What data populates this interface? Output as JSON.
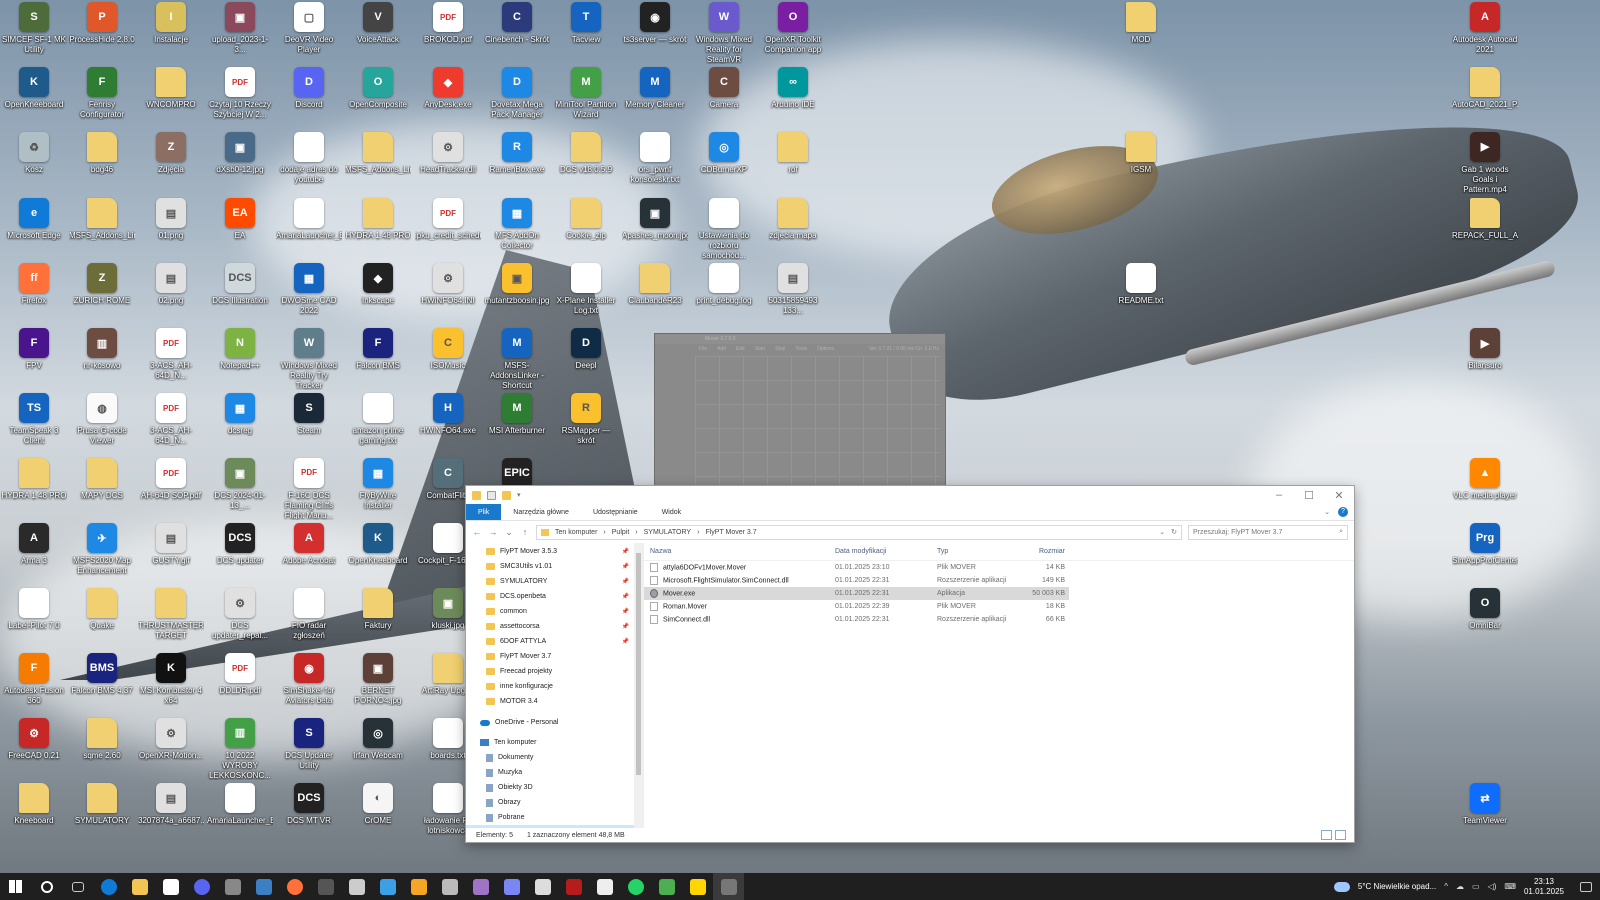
{
  "desktop": {
    "icons": [
      {
        "label": "SIMCEF SF-1 MK Utility",
        "color": "#4e6b3a",
        "glyph": "S"
      },
      {
        "label": "ProcessHide 2.8.0",
        "color": "#e0572a",
        "glyph": "P"
      },
      {
        "label": "Instalacje",
        "color": "#d8c05c",
        "glyph": "I"
      },
      {
        "label": "upload_2023-1-3...",
        "color": "#8a4a5c",
        "glyph": "▣"
      },
      {
        "label": "DeoVR Video Player",
        "color": "#ffffff",
        "glyph": "▢"
      },
      {
        "label": "VoiceAttack",
        "color": "#444444",
        "glyph": "V"
      },
      {
        "label": "BROKOD.pdf",
        "color": "#d32f2f",
        "glyph": "PDF"
      },
      {
        "label": "Cinebench - Skrót",
        "color": "#2a3a7a",
        "glyph": "C"
      },
      {
        "label": "Tacview",
        "color": "#1565c0",
        "glyph": "T"
      },
      {
        "label": "ts3server — skrót",
        "color": "#222222",
        "glyph": "◉"
      },
      {
        "label": "Windows Mixed Reality for SteamVR",
        "color": "#6a5acd",
        "glyph": "W"
      },
      {
        "label": "OpenXR Toolkit Companion app",
        "color": "#7b1fa2",
        "glyph": "O"
      },
      {
        "label": "MOD",
        "color": "#f0d070",
        "glyph": ""
      },
      {
        "label": "Autodesk Autocad 2021",
        "color": "#c62828",
        "glyph": "A"
      }
    ],
    "icons_row2": [
      {
        "label": "OpenKneeboard",
        "color": "#1e5a8a",
        "glyph": "K"
      },
      {
        "label": "Fenrisy Configurator",
        "color": "#2e7d32",
        "glyph": "F"
      },
      {
        "label": "WNCOMPRO",
        "color": "#f0d070",
        "glyph": ""
      },
      {
        "label": "Czytaj 10 Rzeczy Szybciej W 2...",
        "color": "#d32f2f",
        "glyph": "PDF"
      },
      {
        "label": "Discord",
        "color": "#5865f2",
        "glyph": "D"
      },
      {
        "label": "OpenComposite",
        "color": "#26a69a",
        "glyph": "O"
      },
      {
        "label": "AnyDesk.exe",
        "color": "#ef3b2d",
        "glyph": "◆"
      },
      {
        "label": "Dovetax Mega Pack Manager",
        "color": "#1e88e5",
        "glyph": "D"
      },
      {
        "label": "MiniTool Partition Wizard",
        "color": "#43a047",
        "glyph": "M"
      },
      {
        "label": "Memory Cleaner",
        "color": "#1565c0",
        "glyph": "M"
      },
      {
        "label": "Camera",
        "color": "#6d4c41",
        "glyph": "C"
      },
      {
        "label": "Arduino IDE",
        "color": "#00979d",
        "glyph": "∞"
      },
      {
        "label": "AutoCAD_2021_P...",
        "color": "#f0d070",
        "glyph": ""
      }
    ],
    "icons_row3": [
      {
        "label": "Kosz",
        "color": "#b0bec5",
        "glyph": "♻"
      },
      {
        "label": "bdg46",
        "color": "#f0d070",
        "glyph": ""
      },
      {
        "label": "Zdjęcia",
        "color": "#8d6e63",
        "glyph": "Z"
      },
      {
        "label": "dXsb0-12.jpg",
        "color": "#4a6a8a",
        "glyph": "▣"
      },
      {
        "label": "dodaje adres do youtube",
        "color": "#ffffff",
        "glyph": ""
      },
      {
        "label": "MSFS_Addons_Lin...",
        "color": "#f0d070",
        "glyph": ""
      },
      {
        "label": "HeadTracker.dll",
        "color": "#e0e0e0",
        "glyph": "⚙"
      },
      {
        "label": "RamenBox.exe",
        "color": "#1e88e5",
        "glyph": "R"
      },
      {
        "label": "DCS v18.0.5.9",
        "color": "#f0d070",
        "glyph": ""
      },
      {
        "label": "ors_pwnf konsoleskr.txt",
        "color": "#ffffff",
        "glyph": ""
      },
      {
        "label": "CDBurnerXP",
        "color": "#1e88e5",
        "glyph": "◎"
      },
      {
        "label": "rof",
        "color": "#f0d070",
        "glyph": ""
      },
      {
        "label": "IGSM",
        "color": "#f0d070",
        "glyph": ""
      },
      {
        "label": "Gab 1 woods Goals i Pattern.mp4",
        "color": "#3e2723",
        "glyph": "▶"
      }
    ],
    "icons_row4": [
      {
        "label": "Microsoft Edge",
        "color": "#0f7bd6",
        "glyph": "e"
      },
      {
        "label": "MSFS_Addons_Lin...",
        "color": "#f0d070",
        "glyph": ""
      },
      {
        "label": "01.png",
        "color": "#e0e0e0",
        "glyph": "▤"
      },
      {
        "label": "EA",
        "color": "#ff4b00",
        "glyph": "EA"
      },
      {
        "label": "AmariaLauncher_E...",
        "color": "#ffffff",
        "glyph": ""
      },
      {
        "label": "HYDRA 1.48 PRO",
        "color": "#f0d070",
        "glyph": ""
      },
      {
        "label": "ipku_credit_schedu...",
        "color": "#d32f2f",
        "glyph": "PDF"
      },
      {
        "label": "MFS AddOn Collector",
        "color": "#1e88e5",
        "glyph": "▦"
      },
      {
        "label": "Cookie_zip",
        "color": "#f0d070",
        "glyph": ""
      },
      {
        "label": "Apashes_moon.jpg",
        "color": "#263238",
        "glyph": "▣"
      },
      {
        "label": "Ustawienia do rozbioru samochód...",
        "color": "#ffffff",
        "glyph": ""
      },
      {
        "label": "zdjecia mapa",
        "color": "#f0d070",
        "glyph": ""
      },
      {
        "label": "REPACK_FULL_Aut...",
        "color": "#f0d070",
        "glyph": ""
      }
    ],
    "icons_row5": [
      {
        "label": "Firefox",
        "color": "#ff7139",
        "glyph": "ff"
      },
      {
        "label": "ZURICH ROME",
        "color": "#6d6d3a",
        "glyph": "Z"
      },
      {
        "label": "02.png",
        "color": "#e0e0e0",
        "glyph": "▤"
      },
      {
        "label": "DCS Illustration",
        "color": "#cfd8dc",
        "glyph": "DCS"
      },
      {
        "label": "DWOSme CAD 2022",
        "color": "#1565c0",
        "glyph": "▦"
      },
      {
        "label": "Inkscape",
        "color": "#222222",
        "glyph": "◆"
      },
      {
        "label": "HWiNFO64.INI",
        "color": "#e0e0e0",
        "glyph": "⚙"
      },
      {
        "label": "mutantzboosin.jpg",
        "color": "#fbc02d",
        "glyph": "▣"
      },
      {
        "label": "X-Plane Installer Log.txt",
        "color": "#ffffff",
        "glyph": ""
      },
      {
        "label": "ClaubandeR23",
        "color": "#f0d070",
        "glyph": ""
      },
      {
        "label": "print_debug.log",
        "color": "#ffffff",
        "glyph": ""
      },
      {
        "label": "50315859493 133...",
        "color": "#e0e0e0",
        "glyph": "▤"
      },
      {
        "label": "README.txt",
        "color": "#ffffff",
        "glyph": ""
      }
    ],
    "icons_row6": [
      {
        "label": "FPV",
        "color": "#4a148c",
        "glyph": "F"
      },
      {
        "label": "nr-kosowo",
        "color": "#6d4c41",
        "glyph": "▥"
      },
      {
        "label": "3-ACS_AH-64D_N...",
        "color": "#d32f2f",
        "glyph": "PDF"
      },
      {
        "label": "Notepad++",
        "color": "#7cb342",
        "glyph": "N"
      },
      {
        "label": "Windows Mixed Reality Try Tracker",
        "color": "#607d8b",
        "glyph": "W"
      },
      {
        "label": "Falcon BMS",
        "color": "#1a237e",
        "glyph": "F"
      },
      {
        "label": "ISOMusic",
        "color": "#fbc02d",
        "glyph": "C"
      },
      {
        "label": "MSFS-AddonsLinker - Shortcut",
        "color": "#1565c0",
        "glyph": "M"
      },
      {
        "label": "Deepl",
        "color": "#0f2b46",
        "glyph": "D"
      },
      {
        "label": "Bilansuro",
        "color": "#5d4037",
        "glyph": "▶"
      }
    ],
    "icons_row7": [
      {
        "label": "TeamSpeak 3 Client",
        "color": "#1565c0",
        "glyph": "TS"
      },
      {
        "label": "Prusa G-code Viewer",
        "color": "#fafafa",
        "glyph": "◍"
      },
      {
        "label": "3-ACS_AH-64D_N...",
        "color": "#d32f2f",
        "glyph": "PDF"
      },
      {
        "label": "dcsreg",
        "color": "#1e88e5",
        "glyph": "▦"
      },
      {
        "label": "Steam",
        "color": "#1b2838",
        "glyph": "S"
      },
      {
        "label": "amazon prime gaming.txt",
        "color": "#ffffff",
        "glyph": ""
      },
      {
        "label": "HWiNFO64.exe",
        "color": "#1565c0",
        "glyph": "H"
      },
      {
        "label": "MSI Afterburner",
        "color": "#2e7d32",
        "glyph": "M"
      },
      {
        "label": "RSMapper — skrót",
        "color": "#fbc02d",
        "glyph": "R"
      }
    ],
    "icons_row8": [
      {
        "label": "HYDRA 1.48 PRO",
        "color": "#f0d070",
        "glyph": ""
      },
      {
        "label": "MAPY DCS",
        "color": "#f0d070",
        "glyph": ""
      },
      {
        "label": "AH-64D SOP.pdf",
        "color": "#d32f2f",
        "glyph": "PDF"
      },
      {
        "label": "DCS 2024-01-13_...",
        "color": "#6d8a5a",
        "glyph": "▣"
      },
      {
        "label": "F-16C DCS Flaming Cliffs Flight Manu...",
        "color": "#d32f2f",
        "glyph": "PDF"
      },
      {
        "label": "FlyByWire Installer",
        "color": "#1e88e5",
        "glyph": "▦"
      },
      {
        "label": "CombatFlite",
        "color": "#546e7a",
        "glyph": "C"
      },
      {
        "label": "Epic Games",
        "color": "#222222",
        "glyph": "EPIC"
      },
      {
        "label": "VLC media player",
        "color": "#ff8800",
        "glyph": "▲"
      }
    ],
    "icons_row9": [
      {
        "label": "Arma 3",
        "color": "#2a2a2a",
        "glyph": "A"
      },
      {
        "label": "MSFS2020 Map Enhancement",
        "color": "#1e88e5",
        "glyph": "✈"
      },
      {
        "label": "GUSTY.gif",
        "color": "#e0e0e0",
        "glyph": "▤"
      },
      {
        "label": "DCS updater",
        "color": "#222222",
        "glyph": "DCS"
      },
      {
        "label": "Adobe Acrobat",
        "color": "#d32f2f",
        "glyph": "A"
      },
      {
        "label": "OpenKneeboard",
        "color": "#1e5a8a",
        "glyph": "K"
      },
      {
        "label": "Cockpit_F-16C...",
        "color": "#ffffff",
        "glyph": ""
      },
      {
        "label": "SimAppProfCenterProg...",
        "color": "#1565c0",
        "glyph": "Prg"
      }
    ],
    "icons_row10": [
      {
        "label": "Label-Pilot 7.0",
        "color": "#ffffff",
        "glyph": ""
      },
      {
        "label": "Quake",
        "color": "#f0d070",
        "glyph": ""
      },
      {
        "label": "THRUSTMASTER TARGET",
        "color": "#f0d070",
        "glyph": ""
      },
      {
        "label": "DCS updater_repai...",
        "color": "#e0e0e0",
        "glyph": "⚙"
      },
      {
        "label": "FIO radar zgłoszeń",
        "color": "#ffffff",
        "glyph": ""
      },
      {
        "label": "Faktury",
        "color": "#f0d070",
        "glyph": ""
      },
      {
        "label": "kluski.jpg",
        "color": "#6d8a5a",
        "glyph": "▣"
      },
      {
        "label": "OmniBar",
        "color": "#263238",
        "glyph": "O"
      }
    ],
    "icons_row11": [
      {
        "label": "Autodesk Fusion 360",
        "color": "#f57c00",
        "glyph": "F"
      },
      {
        "label": "Falcon BMS 4.37",
        "color": "#1a237e",
        "glyph": "BMS"
      },
      {
        "label": "MSI Kombustor 4 x64",
        "color": "#111111",
        "glyph": "K"
      },
      {
        "label": "DDLDR.pdf",
        "color": "#d32f2f",
        "glyph": "PDF"
      },
      {
        "label": "SimShaker for Aviators beta",
        "color": "#c62828",
        "glyph": "◉"
      },
      {
        "label": "BERNET PORNO4.jpg",
        "color": "#5d4037",
        "glyph": "▣"
      },
      {
        "label": "ArtiRay Upgr...",
        "color": "#f0d070",
        "glyph": ""
      }
    ],
    "icons_row12": [
      {
        "label": "FreeCAD 0.21",
        "color": "#c62828",
        "glyph": "⚙"
      },
      {
        "label": "sqme 2.60",
        "color": "#f0d070",
        "glyph": ""
      },
      {
        "label": "OpenXR-Motion...",
        "color": "#e0e0e0",
        "glyph": "⚙"
      },
      {
        "label": "10 2022 WYROBY LEKKOSKONC...",
        "color": "#43a047",
        "glyph": "▥"
      },
      {
        "label": "DCS Updater Utility",
        "color": "#1a237e",
        "glyph": "S"
      },
      {
        "label": "Irfan Webcam",
        "color": "#263238",
        "glyph": "◎"
      },
      {
        "label": "boards.txt",
        "color": "#ffffff",
        "glyph": ""
      }
    ],
    "icons_row13": [
      {
        "label": "Kneeboard",
        "color": "#f0d070",
        "glyph": ""
      },
      {
        "label": "SYMULATORY",
        "color": "#f0d070",
        "glyph": ""
      },
      {
        "label": "3207874a_a6687...",
        "color": "#e0e0e0",
        "glyph": "▤"
      },
      {
        "label": "AmariaLauncher_E...",
        "color": "#ffffff",
        "glyph": ""
      },
      {
        "label": "DCS MT VR",
        "color": "#222222",
        "glyph": "DCS"
      },
      {
        "label": "CrOME",
        "color": "#f5f5f5",
        "glyph": "◐"
      },
      {
        "label": "ładowanie FT lotniskowca",
        "color": "#ffffff",
        "glyph": ""
      },
      {
        "label": "TeamViewer",
        "color": "#0e6dfd",
        "glyph": "⇄"
      }
    ]
  },
  "mover_window": {
    "title": "Mover 3.7.0.0",
    "menu": [
      "File",
      "Add",
      "Edit",
      "Start",
      "Stop",
      "Tools",
      "Options"
    ],
    "status": "Ver 3.7   01 / 0.00 ms   Cn: 1.0 Hz"
  },
  "explorer": {
    "ribbon_tabs": [
      "Plik",
      "Narzędzia główne",
      "Udostępnianie",
      "Widok"
    ],
    "breadcrumb": [
      "Ten komputer",
      "Pulpit",
      "SYMULATORY",
      "FlyPT Mover 3.7"
    ],
    "search_placeholder": "Przeszukaj: FlyPT Mover 3.7",
    "nav_pinned": [
      {
        "label": "FlyPT Mover 3.5.3",
        "pinned": true
      },
      {
        "label": "SMC3Utils v1.01",
        "pinned": true
      },
      {
        "label": "SYMULATORY",
        "pinned": true
      },
      {
        "label": "DCS.openbeta",
        "pinned": true
      },
      {
        "label": "common",
        "pinned": true
      },
      {
        "label": "assettocorsa",
        "pinned": true
      },
      {
        "label": "6DOF ATTYLA",
        "pinned": true
      },
      {
        "label": "FlyPT Mover 3.7",
        "pinned": false
      },
      {
        "label": "Freecad projekty",
        "pinned": false
      },
      {
        "label": "inne konfiguracje",
        "pinned": false
      },
      {
        "label": "MOTOR 3.4",
        "pinned": false
      }
    ],
    "pin_glyph": "📌",
    "onedrive": "OneDrive - Personal",
    "this_pc": "Ten komputer",
    "pc_items": [
      "Dokumenty",
      "Muzyka",
      "Obiekty 3D",
      "Obrazy",
      "Pobrane",
      "Pulpit"
    ],
    "columns": {
      "name": "Nazwa",
      "date": "Data modyfikacji",
      "type": "Typ",
      "size": "Rozmiar"
    },
    "files": [
      {
        "name": "attyla6DOFv1Mover.Mover",
        "date": "01.01.2025 23:10",
        "type": "Plik MOVER",
        "size": "14 KB",
        "selected": false,
        "exe": false
      },
      {
        "name": "Microsoft.FlightSimulator.SimConnect.dll",
        "date": "01.01.2025 22:31",
        "type": "Rozszerzenie aplikacji",
        "size": "149 KB",
        "selected": false,
        "exe": false
      },
      {
        "name": "Mover.exe",
        "date": "01.01.2025 22:31",
        "type": "Aplikacja",
        "size": "50 003 KB",
        "selected": true,
        "exe": true
      },
      {
        "name": "Roman.Mover",
        "date": "01.01.2025 22:39",
        "type": "Plik MOVER",
        "size": "18 KB",
        "selected": false,
        "exe": false
      },
      {
        "name": "SimConnect.dll",
        "date": "01.01.2025 22:31",
        "type": "Rozszerzenie aplikacji",
        "size": "66 KB",
        "selected": false,
        "exe": false
      }
    ],
    "status_count": "Elementy: 5",
    "status_selected": "1 zaznaczony element 48,8 MB"
  },
  "taskbar": {
    "icons": [
      {
        "name": "start",
        "color": "#ffffff"
      },
      {
        "name": "search",
        "color": "#ffffff"
      },
      {
        "name": "task-view",
        "color": "#cccccc"
      },
      {
        "name": "edge",
        "color": "#0f7bd6"
      },
      {
        "name": "file-explorer",
        "color": "#f3c653"
      },
      {
        "name": "store",
        "color": "#ffffff"
      },
      {
        "name": "discord",
        "color": "#5865f2"
      },
      {
        "name": "app-1",
        "color": "#888888"
      },
      {
        "name": "app-2",
        "color": "#3b7fc4"
      },
      {
        "name": "firefox",
        "color": "#ff7139"
      },
      {
        "name": "app-3",
        "color": "#555555"
      },
      {
        "name": "app-4",
        "color": "#cccccc"
      },
      {
        "name": "app-5",
        "color": "#3ba0e6"
      },
      {
        "name": "dcs",
        "color": "#f5a623"
      },
      {
        "name": "app-6",
        "color": "#bbbbbb"
      },
      {
        "name": "visual-studio",
        "color": "#a074c4"
      },
      {
        "name": "discord-2",
        "color": "#7a86f2"
      },
      {
        "name": "app-7",
        "color": "#dddddd"
      },
      {
        "name": "app-8",
        "color": "#b71c1c"
      },
      {
        "name": "app-9",
        "color": "#eeeeee"
      },
      {
        "name": "whatsapp",
        "color": "#25d366"
      },
      {
        "name": "app-10",
        "color": "#4caf50"
      },
      {
        "name": "sticky-notes",
        "color": "#ffd600"
      },
      {
        "name": "mover",
        "color": "#777777"
      }
    ],
    "active_index": 23,
    "weather": "5°C  Niewielkie opad...",
    "tray_glyphs": [
      "^",
      "☁",
      "▭",
      "◁)",
      "⌨"
    ],
    "time": "23:13",
    "date": "01.01.2025"
  },
  "colors": {
    "accent": "#1979ca",
    "folder": "#f3c653",
    "selection": "#cce8ff"
  }
}
